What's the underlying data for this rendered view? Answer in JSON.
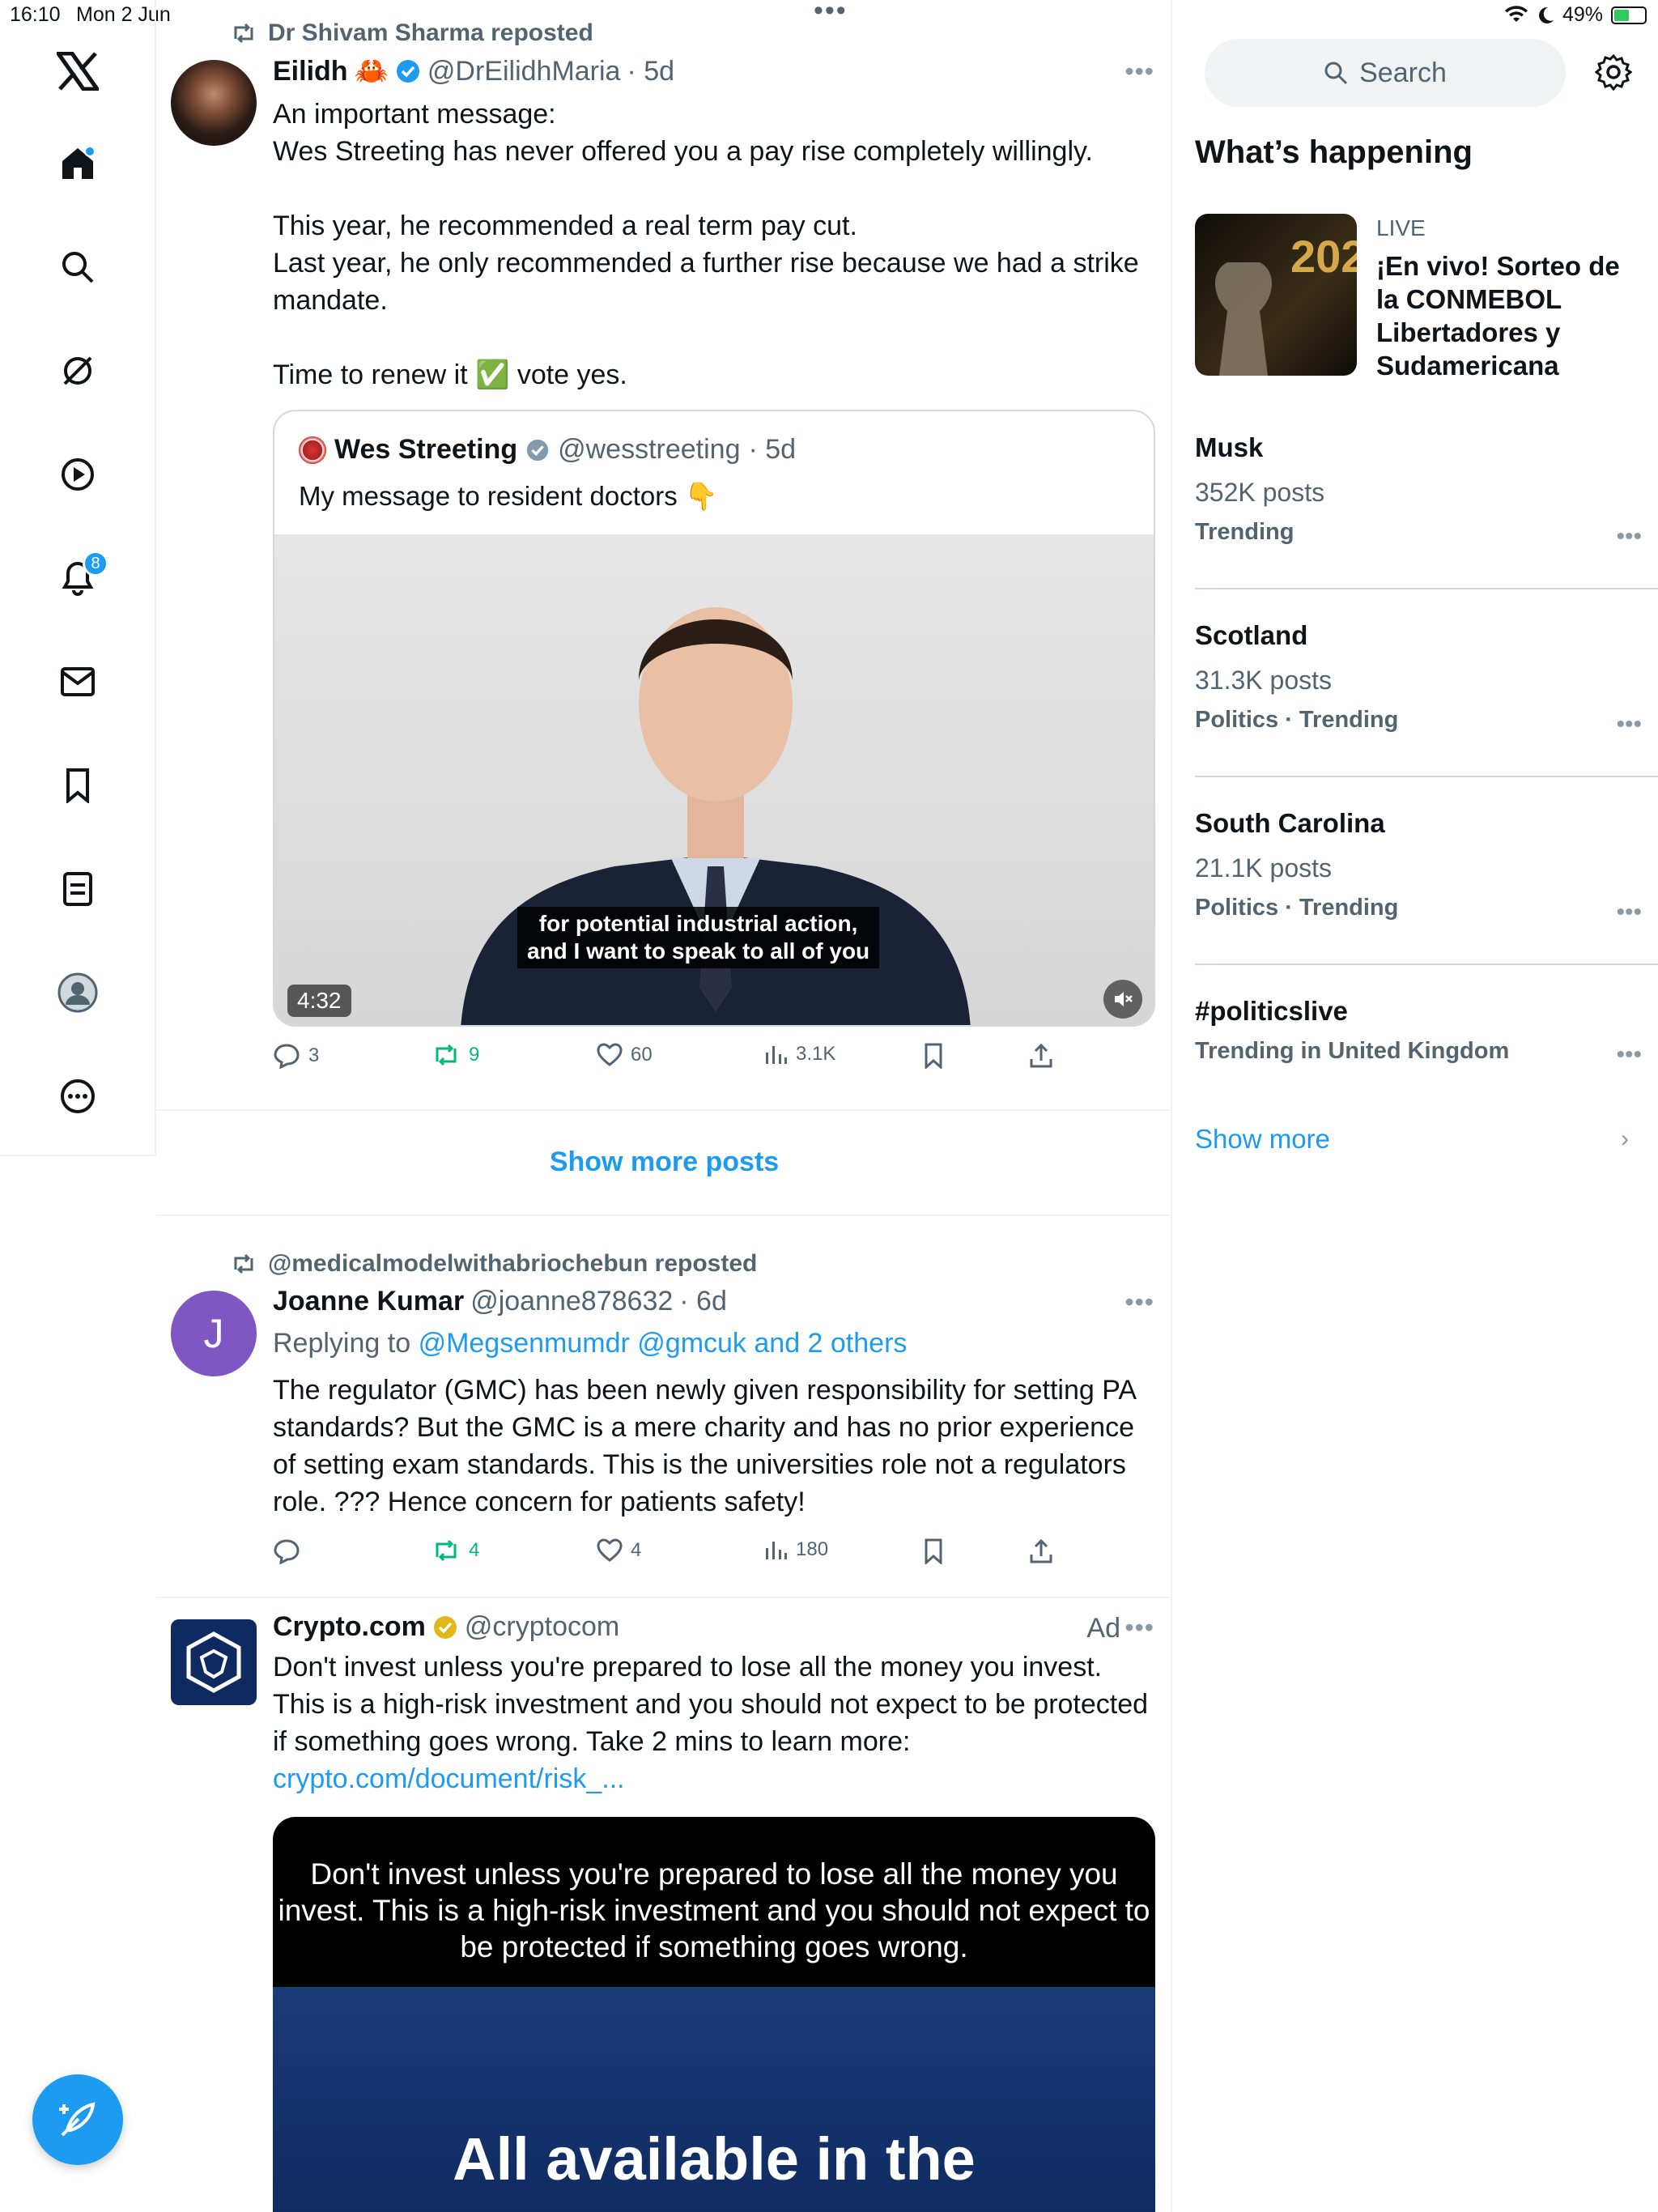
{
  "status_bar": {
    "time": "16:10",
    "date": "Mon 2 Jun",
    "battery": "49%"
  },
  "nav": {
    "notifications_badge": "8"
  },
  "tweets": [
    {
      "repost_label": "Dr Shivam Sharma reposted",
      "name": "Eilidh",
      "emoji": "🦀",
      "handle": "@DrEilidhMaria",
      "age": "· 5d",
      "lines": [
        "An important message:",
        "Wes Streeting has never offered you a pay rise completely willingly.",
        "",
        "This year, he recommended a real term pay cut.",
        "Last year, he only recommended a further rise because we had a strike mandate.",
        "",
        "Time to renew it ✅ vote yes."
      ],
      "quote": {
        "name": "Wes Streeting",
        "handle": "@wesstreeting",
        "age": "· 5d",
        "text": "My message to resident doctors 👇",
        "caption_line1": "for potential industrial action,",
        "caption_line2": "and I want to speak to all of you",
        "duration": "4:32"
      },
      "stats": {
        "replies": "3",
        "reposts": "9",
        "likes": "60",
        "views": "3.1K"
      }
    },
    {
      "repost_label": "@medicalmodelwithabriochebun reposted",
      "avatar_letter": "J",
      "name": "Joanne Kumar",
      "handle": "@joanne878632",
      "age": "· 6d",
      "replying_prefix": "Replying to",
      "replying_to": "@Megsenmumdr @gmcuk and 2 others",
      "text": "The regulator (GMC) has been newly given responsibility for setting PA standards? But the GMC is a mere charity and has no prior experience of setting exam standards. This is the universities role not a regulators role. ??? Hence concern for patients safety!",
      "stats": {
        "replies": "",
        "reposts": "4",
        "likes": "4",
        "views": "180"
      }
    },
    {
      "name": "Crypto.com",
      "handle": "@cryptocom",
      "ad_label": "Ad",
      "text": "Don't invest unless you're prepared to lose all the money you invest. This is a high-risk investment and you should not expect to be protected if something goes wrong. Take 2 mins to learn more:",
      "link": "crypto.com/document/risk_...",
      "image_text": "Don't invest unless you're prepared to lose all the money you invest. This is a high-risk investment and you should not expect to be protected if something goes wrong.",
      "image_big_text": "All available in the"
    }
  ],
  "show_more_posts": "Show more posts",
  "sidebar": {
    "search_placeholder": "Search",
    "whats_happening": "What’s happening",
    "live": {
      "label": "LIVE",
      "text": "¡En vivo! Sorteo de la CONMEBOL Libertadores y Sudamericana",
      "thumb_text": "202"
    },
    "trends": [
      {
        "title": "Musk",
        "posts": "352K posts",
        "sub": "Trending"
      },
      {
        "title": "Scotland",
        "posts": "31.3K posts",
        "sub": "Politics · Trending"
      },
      {
        "title": "South Carolina",
        "posts": "21.1K posts",
        "sub": "Politics · Trending"
      },
      {
        "title": "#politicslive",
        "posts": "",
        "sub": "Trending in United Kingdom"
      }
    ],
    "show_more": "Show more"
  },
  "colors": {
    "accent": "#1d9bf0",
    "repost_green": "#00ba7c",
    "muted": "#536471"
  }
}
